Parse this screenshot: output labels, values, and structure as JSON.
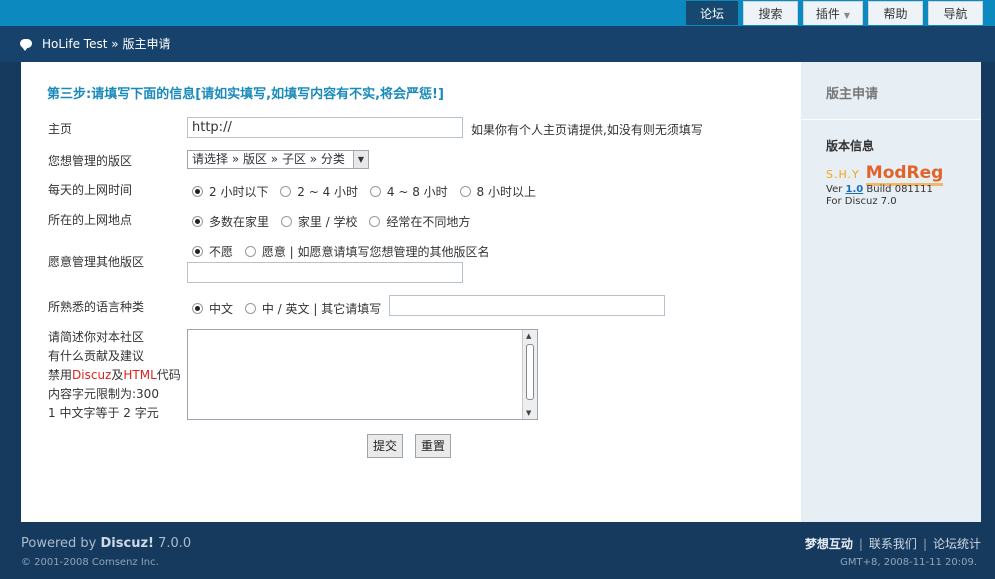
{
  "nav": {
    "tabs": [
      {
        "label": "论坛",
        "active": true
      },
      {
        "label": "搜索",
        "active": false
      },
      {
        "label": "插件",
        "active": false,
        "dropdown": true
      },
      {
        "label": "帮助",
        "active": false
      },
      {
        "label": "导航",
        "active": false
      }
    ]
  },
  "breadcrumb": {
    "site": "HoLife Test",
    "separator": "»",
    "page": "版主申请"
  },
  "form": {
    "step_title": "第三步:请填写下面的信息[请如实填写,如填写内容有不实,将会严惩!]",
    "homepage": {
      "label": "主页",
      "value": "http://",
      "hint": "如果你有个人主页请提供,如没有则无须填写"
    },
    "forum": {
      "label": "您想管理的版区",
      "selected": "请选择 » 版区 » 子区 » 分类"
    },
    "online_time": {
      "label": "每天的上网时间",
      "options": [
        "2 小时以下",
        "2 ~ 4 小时",
        "4 ~ 8 小时",
        "8 小时以上"
      ],
      "selected_index": 0
    },
    "online_place": {
      "label": "所在的上网地点",
      "options": [
        "多数在家里",
        "家里 / 学校",
        "经常在不同地方"
      ],
      "selected_index": 0
    },
    "other_forums": {
      "label": "愿意管理其他版区",
      "options": [
        "不愿",
        "愿意 | 如愿意请填写您想管理的其他版区名"
      ],
      "selected_index": 0,
      "value": ""
    },
    "language": {
      "label": "所熟悉的语言种类",
      "options": [
        "中文",
        "中 / 英文 | 其它请填写"
      ],
      "selected_index": 0,
      "value": ""
    },
    "description": {
      "line1": "请简述你对本社区",
      "line2": "有什么贡献及建议",
      "line3_pre": "禁用",
      "line3_discuz": "Discuz",
      "line3_mid": "及",
      "line3_html": "HTML",
      "line3_post": "代码",
      "line4": "内容字元限制为:300",
      "line5": "1 中文字等于 2 字元",
      "value": ""
    },
    "submit_label": "提交",
    "reset_label": "重置"
  },
  "sidebar": {
    "title": "版主申请",
    "info_label": "版本信息",
    "logo_small": "S.H.Y",
    "logo_big": "ModReg",
    "ver_prefix": "Ver",
    "ver_link": "1.0",
    "build": "Build 081111",
    "for_text": "For Discuz 7.0"
  },
  "footer": {
    "powered_prefix": "Powered by",
    "powered_name": "Discuz!",
    "powered_version": "7.0.0",
    "copyright": "© 2001-2008 Comsenz Inc.",
    "links": [
      "梦想互动",
      "联系我们",
      "论坛统计"
    ],
    "timestamp": "GMT+8, 2008-11-11 20:09."
  },
  "colors": {
    "accent": "#0c89bf",
    "header_dark": "#17426b",
    "step_title": "#1a8aba",
    "logo_orange": "#e0642a"
  }
}
